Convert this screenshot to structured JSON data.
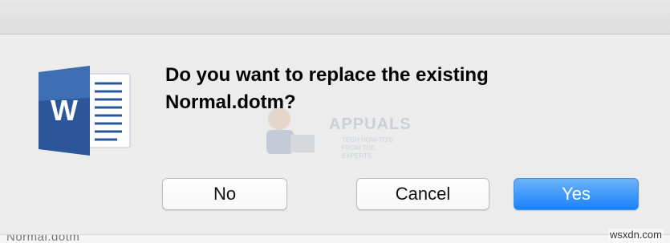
{
  "dialog": {
    "message": "Do you want to replace the existing Normal.dotm?",
    "buttons": {
      "no_label": "No",
      "cancel_label": "Cancel",
      "yes_label": "Yes"
    }
  },
  "app_icon": {
    "name": "word-icon",
    "letter": "W",
    "colors": {
      "primary": "#2b579a",
      "light": "#4a7bc4",
      "page": "#ffffff"
    }
  },
  "watermark": {
    "text": "APPUALS",
    "subtext": "TECH HOW-TO'S FROM THE EXPERTS"
  },
  "background_text": "Normal.dotm",
  "credit": "wsxdn.com",
  "colors": {
    "default_button": "#1a82fb",
    "background": "#ececec"
  }
}
